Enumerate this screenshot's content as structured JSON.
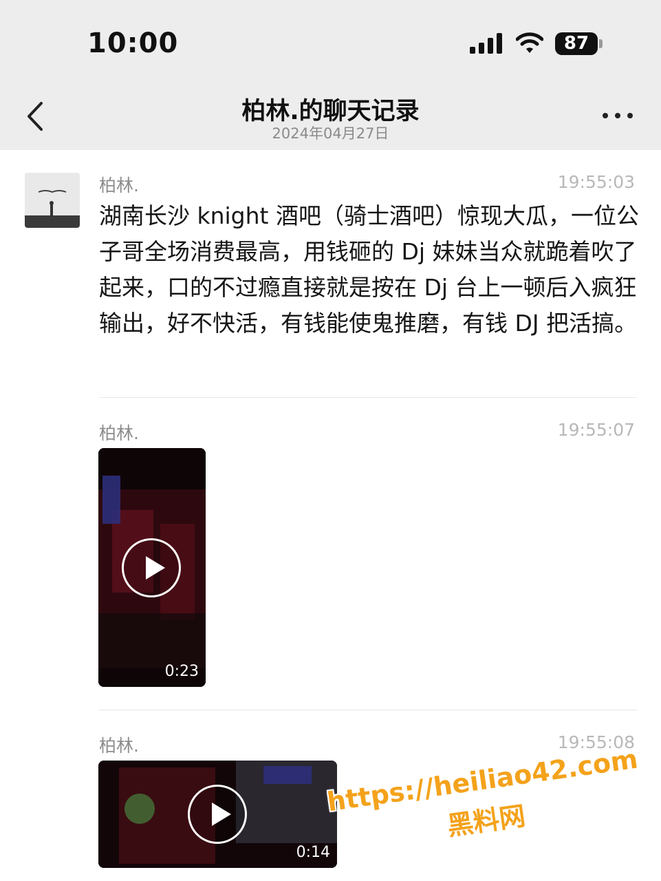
{
  "status_bar": {
    "time": "10:00",
    "battery": "87"
  },
  "header": {
    "title": "柏林.的聊天记录",
    "date": "2024年04月27日"
  },
  "messages": [
    {
      "sender": "柏林.",
      "time": "19:55:03",
      "text": "湖南长沙 knight 酒吧（骑士酒吧）惊现大瓜，一位公子哥全场消费最高，用钱砸的 Dj 妹妹当众就跪着吹了起来，口的不过瘾直接就是按在 Dj 台上一顿后入疯狂输出，好不快活，有钱能使鬼推磨，有钱 DJ 把活搞。"
    },
    {
      "sender": "柏林.",
      "time": "19:55:07",
      "video_duration": "0:23"
    },
    {
      "sender": "柏林.",
      "time": "19:55:08",
      "video_duration": "0:14"
    }
  ],
  "watermark": {
    "url": "https://heiliao42.com",
    "name": "黑料网"
  },
  "icons": {
    "back": "chevron-left-icon",
    "more": "more-dots-icon",
    "play": "play-icon",
    "signal": "signal-icon",
    "wifi": "wifi-icon"
  }
}
